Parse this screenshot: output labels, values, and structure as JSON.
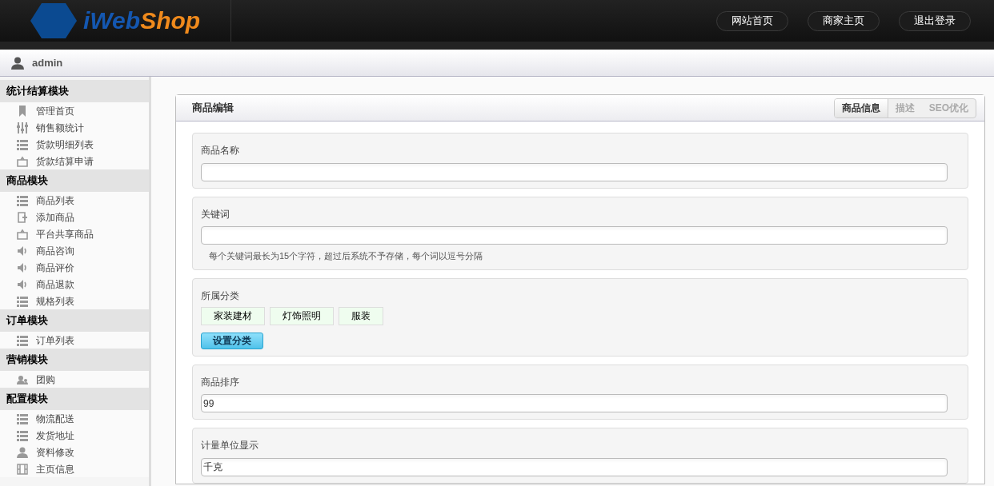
{
  "header": {
    "logo": {
      "part_1": "iWeb",
      "part_2": "Shop"
    },
    "buttons": [
      "网站首页",
      "商家主页",
      "退出登录"
    ]
  },
  "user_bar": {
    "username": "admin"
  },
  "sidebar": {
    "groups": [
      {
        "title": "统计结算模块",
        "items": [
          "管理首页",
          "销售额统计",
          "货款明细列表",
          "货款结算申请"
        ]
      },
      {
        "title": "商品模块",
        "items": [
          "商品列表",
          "添加商品",
          "平台共享商品",
          "商品咨询",
          "商品评价",
          "商品退款",
          "规格列表"
        ]
      },
      {
        "title": "订单模块",
        "items": [
          "订单列表"
        ]
      },
      {
        "title": "营销模块",
        "items": [
          "团购"
        ]
      },
      {
        "title": "配置模块",
        "items": [
          "物流配送",
          "发货地址",
          "资料修改",
          "主页信息"
        ]
      }
    ]
  },
  "panel": {
    "title": "商品编辑",
    "tabs": [
      {
        "label": "商品信息",
        "selected": true
      },
      {
        "label": "描述",
        "selected": false
      },
      {
        "label": "SEO优化",
        "selected": false
      }
    ],
    "sections": [
      {
        "kind": "input",
        "label": "商品名称"
      },
      {
        "kind": "input",
        "label": "关键词",
        "hint": "每个关键词最长为15个字符，超过后系统不予存储，每个词以逗号分隔"
      },
      {
        "kind": "categories",
        "label": "所属分类",
        "tags": [
          "家装建材",
          "灯饰照明",
          "服装"
        ],
        "button": "设置分类"
      },
      {
        "kind": "input",
        "label": "商品排序",
        "value": "99"
      },
      {
        "kind": "input",
        "label": "计量单位显示",
        "value": "千克"
      }
    ]
  }
}
